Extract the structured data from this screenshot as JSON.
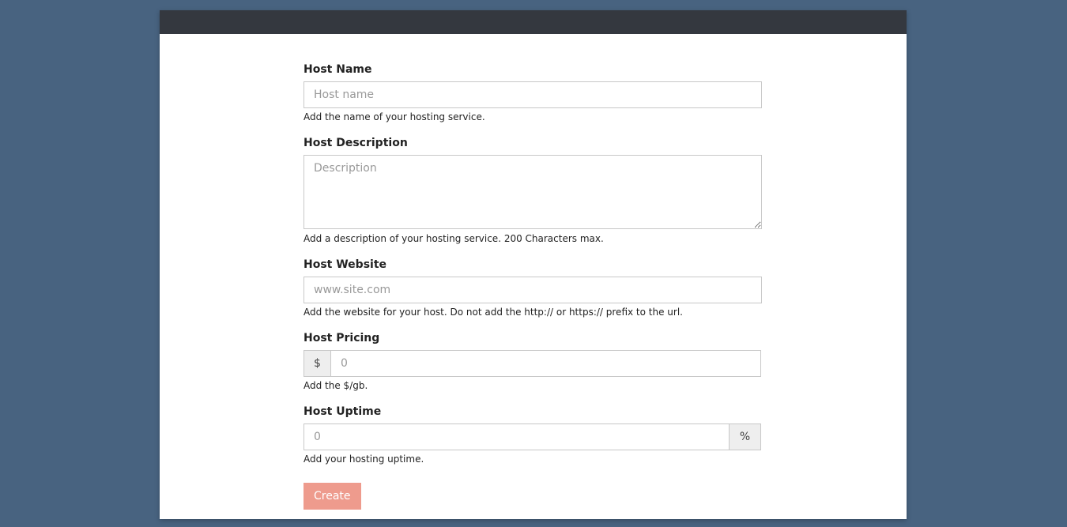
{
  "form": {
    "host_name": {
      "label": "Host Name",
      "placeholder": "Host name",
      "help": "Add the name of your hosting service."
    },
    "host_description": {
      "label": "Host Description",
      "placeholder": "Description",
      "help": "Add a description of your hosting service. 200 Characters max."
    },
    "host_website": {
      "label": "Host Website",
      "placeholder": "www.site.com",
      "help": "Add the website for your host. Do not add the http:// or https:// prefix to the url."
    },
    "host_pricing": {
      "label": "Host Pricing",
      "addon": "$",
      "placeholder": "0",
      "help": "Add the $/gb."
    },
    "host_uptime": {
      "label": "Host Uptime",
      "addon": "%",
      "placeholder": "0",
      "help": "Add your hosting uptime."
    },
    "submit_label": "Create"
  },
  "colors": {
    "page_background": "#486380",
    "topbar": "#34383f",
    "button": "#ee9b8d"
  }
}
